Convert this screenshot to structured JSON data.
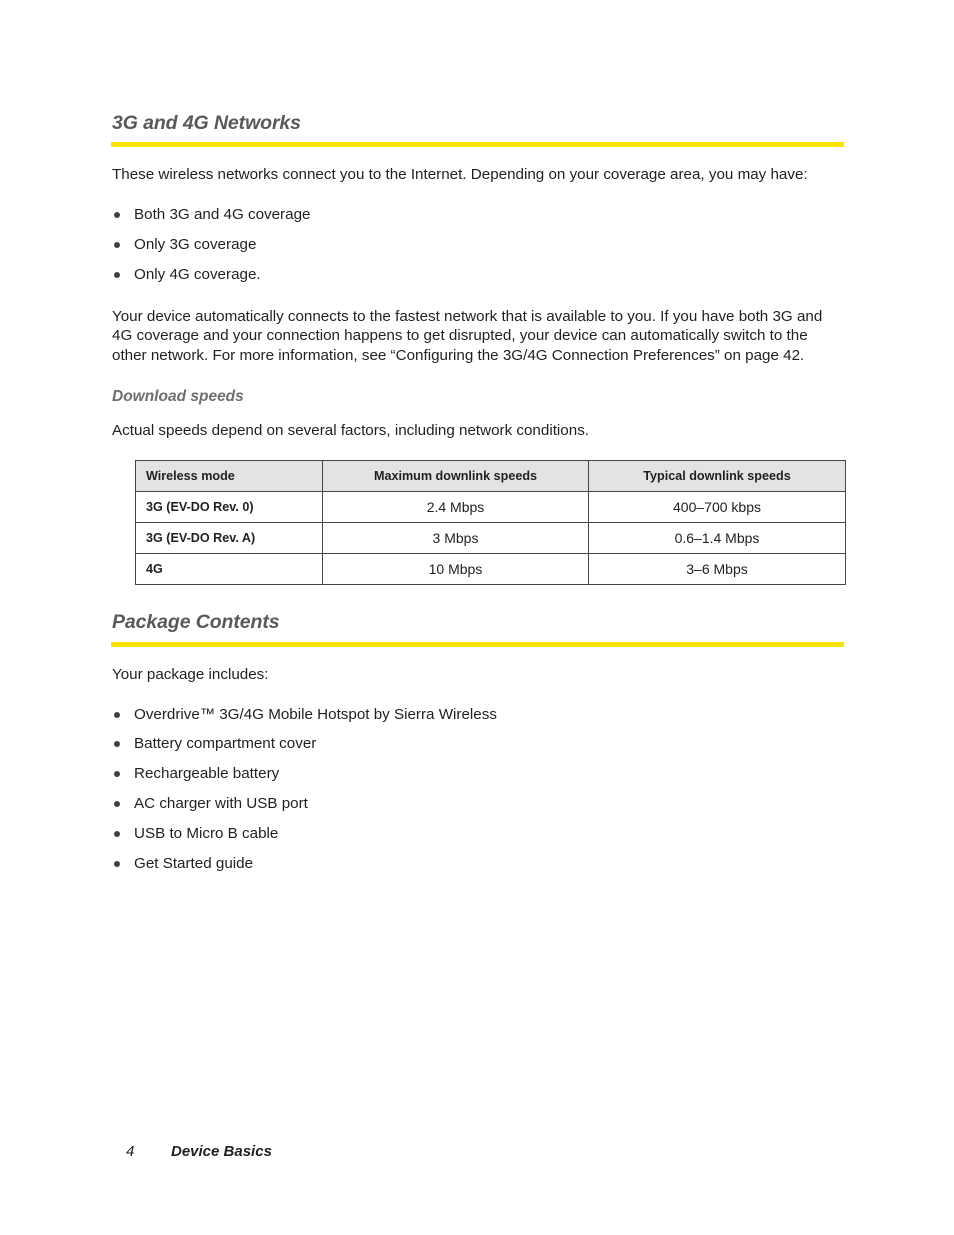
{
  "document": {
    "footer": {
      "page_number": "4",
      "section_title": "Device Basics"
    }
  },
  "sections": [
    {
      "heading": "3G and 4G Networks",
      "intro_paragraph": "These wireless networks connect you to the Internet. Depending on your coverage area, you may have:",
      "coverage_bullets": [
        "Both 3G and 4G coverage",
        "Only 3G coverage",
        "Only 4G coverage."
      ],
      "detail_paragraph": "Your device automatically connects to the fastest network that is available to you. If you have both 3G and 4G coverage and your connection happens to get disrupted, your device can automatically switch to the other network. For more information, see “Configuring the 3G/4G Connection Preferences” on page 42.",
      "subheading": "Download speeds",
      "subheading_paragraph": "Actual speeds depend on several factors, including network conditions."
    },
    {
      "heading": "Package Contents",
      "intro_paragraph": "Your package includes:",
      "package_bullets": [
        "Overdrive™ 3G/4G Mobile Hotspot by Sierra Wireless",
        "Battery compartment cover",
        "Rechargeable battery",
        "AC charger with USB port",
        "USB to Micro B cable",
        "Get Started guide"
      ]
    }
  ],
  "speeds_table": {
    "columns": [
      "Wireless mode",
      "Maximum downlink speeds",
      "Typical downlink speeds"
    ],
    "rows": [
      {
        "mode": "3G (EV-DO Rev. 0)",
        "maximum": "2.4 Mbps",
        "typical": "400–700 kbps"
      },
      {
        "mode": "3G (EV-DO Rev. A)",
        "maximum": "3 Mbps",
        "typical": "0.6–1.4 Mbps"
      },
      {
        "mode": "4G",
        "maximum": "10 Mbps",
        "typical": "3–6 Mbps"
      }
    ]
  },
  "colors": {
    "accent_rule": "#fde400",
    "heading_text": "#58595b",
    "body_text": "#231f20",
    "table_header_bg": "#e3e3e3",
    "table_border": "#444447"
  }
}
